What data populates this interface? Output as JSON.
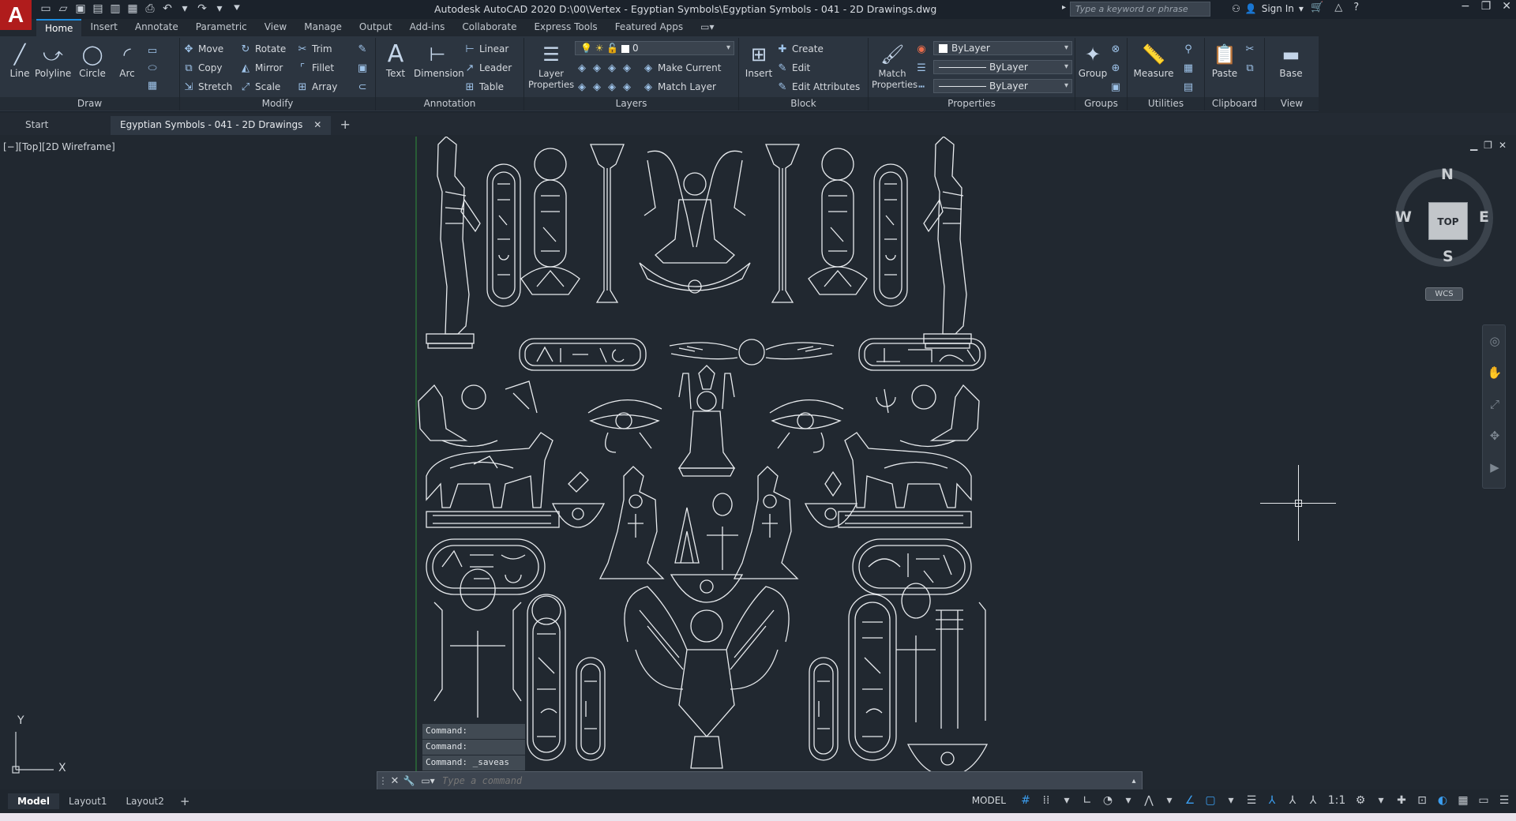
{
  "app": {
    "logo": "A",
    "title": "Autodesk AutoCAD 2020   D:\\00\\Vertex - Egyptian Symbols\\Egyptian Symbols - 041 - 2D Drawings.dwg",
    "search_placeholder": "Type a keyword or phrase",
    "sign_in": "Sign In"
  },
  "menu_tabs": [
    {
      "label": "Home",
      "active": true
    },
    {
      "label": "Insert"
    },
    {
      "label": "Annotate"
    },
    {
      "label": "Parametric"
    },
    {
      "label": "View"
    },
    {
      "label": "Manage"
    },
    {
      "label": "Output"
    },
    {
      "label": "Add-ins"
    },
    {
      "label": "Collaborate"
    },
    {
      "label": "Express Tools"
    },
    {
      "label": "Featured Apps"
    }
  ],
  "ribbon": {
    "draw": {
      "title": "Draw",
      "line": "Line",
      "polyline": "Polyline",
      "circle": "Circle",
      "arc": "Arc"
    },
    "modify": {
      "title": "Modify",
      "move": "Move",
      "rotate": "Rotate",
      "trim": "Trim",
      "copy": "Copy",
      "mirror": "Mirror",
      "fillet": "Fillet",
      "stretch": "Stretch",
      "scale": "Scale",
      "array": "Array"
    },
    "annotation": {
      "title": "Annotation",
      "text": "Text",
      "dimension": "Dimension",
      "linear": "Linear",
      "leader": "Leader",
      "table": "Table"
    },
    "layers": {
      "title": "Layers",
      "layer_properties": "Layer Properties",
      "current_layer": "0",
      "make_current": "Make Current",
      "match_layer": "Match Layer"
    },
    "block": {
      "title": "Block",
      "insert": "Insert",
      "create": "Create",
      "edit": "Edit",
      "edit_attributes": "Edit Attributes"
    },
    "properties": {
      "title": "Properties",
      "match_properties": "Match Properties",
      "color": "ByLayer",
      "linetype": "ByLayer",
      "lineweight": "ByLayer"
    },
    "groups": {
      "title": "Groups",
      "group": "Group"
    },
    "utilities": {
      "title": "Utilities",
      "measure": "Measure"
    },
    "clipboard": {
      "title": "Clipboard",
      "paste": "Paste"
    },
    "view": {
      "title": "View",
      "base": "Base"
    }
  },
  "doc_tabs": [
    {
      "label": "Start"
    },
    {
      "label": "Egyptian Symbols - 041 - 2D Drawings",
      "active": true
    }
  ],
  "viewport": {
    "label": "[−][Top][2D Wireframe]",
    "viewcube": {
      "n": "N",
      "s": "S",
      "e": "E",
      "w": "W",
      "top": "TOP",
      "wcs": "WCS"
    },
    "ucs_x": "X",
    "ucs_y": "Y"
  },
  "command": {
    "history": [
      "Command:",
      "Command:",
      "Command:  _saveas"
    ],
    "placeholder": "Type a command"
  },
  "layout_tabs": [
    {
      "label": "Model",
      "active": true
    },
    {
      "label": "Layout1"
    },
    {
      "label": "Layout2"
    }
  ],
  "status": {
    "mode": "MODEL",
    "scale": "1:1"
  },
  "colors": {
    "accent": "#1d8de0",
    "background": "#212830",
    "linework": "#e8ebee",
    "logo": "#b01c1c"
  }
}
